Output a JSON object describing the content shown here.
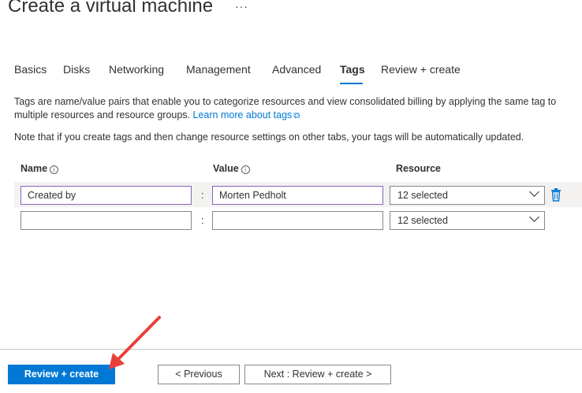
{
  "page": {
    "title": "Create a virtual machine",
    "more": "···"
  },
  "tabs": [
    {
      "label": "Basics"
    },
    {
      "label": "Disks"
    },
    {
      "label": "Networking"
    },
    {
      "label": "Management"
    },
    {
      "label": "Advanced"
    },
    {
      "label": "Tags"
    },
    {
      "label": "Review + create"
    }
  ],
  "active_tab": "Tags",
  "description": {
    "text": "Tags are name/value pairs that enable you to categorize resources and view consolidated billing by applying the same tag to multiple resources and resource groups.",
    "link": "Learn more about tags"
  },
  "note": "Note that if you create tags and then change resource settings on other tabs, your tags will be automatically updated.",
  "columns": {
    "name": "Name",
    "value": "Value",
    "resource": "Resource"
  },
  "rows": [
    {
      "name": "Created by",
      "value": "Morten Pedholt",
      "resource": "12 selected",
      "separator": ":"
    },
    {
      "name": "",
      "value": "",
      "resource": "12 selected",
      "separator": ":"
    }
  ],
  "footer": {
    "review_create": "Review + create",
    "previous": "< Previous",
    "next": "Next : Review + create >"
  },
  "colors": {
    "accent": "#0078d4",
    "annotation_arrow": "#e8413c",
    "focus_border": "#8764b8"
  }
}
